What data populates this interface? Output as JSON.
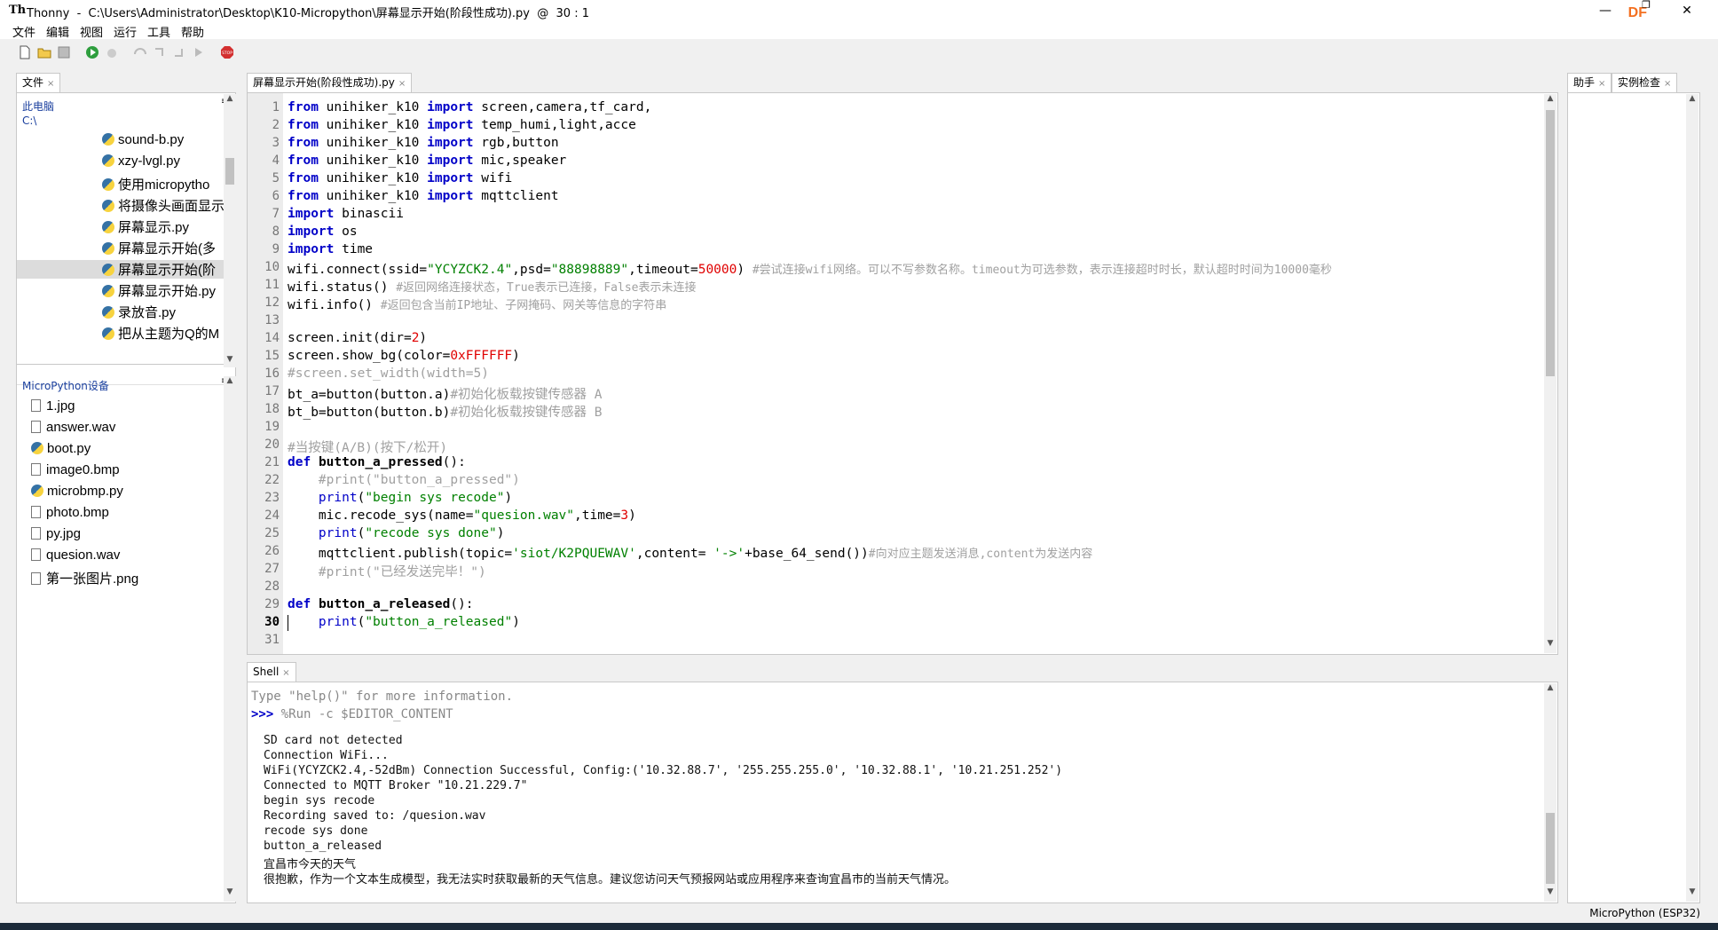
{
  "window": {
    "app_name": "Thonny",
    "path": "C:\\Users\\Administrator\\Desktop\\K10-Micropython\\屏幕显示开始(阶段性成功).py",
    "cursor": "@  30 : 1",
    "brand": "DF",
    "minimize": "—",
    "restore": "❐",
    "close": "✕"
  },
  "menu": [
    "文件",
    "编辑",
    "视图",
    "运行",
    "工具",
    "帮助"
  ],
  "files_panel": {
    "tab": "文件",
    "section1_title": "此电脑",
    "drive": "C:\\",
    "computer_files": [
      "sound-b.py",
      "xzy-lvgl.py",
      "使用micropytho",
      "将摄像头画面显示",
      "屏幕显示.py",
      "屏幕显示开始(多",
      "屏幕显示开始(阶",
      "屏幕显示开始.py",
      "录放音.py",
      "把从主题为Q的M"
    ],
    "section2_title": "MicroPython设备",
    "device_files": [
      {
        "name": "1.jpg",
        "type": "file"
      },
      {
        "name": "answer.wav",
        "type": "file"
      },
      {
        "name": "boot.py",
        "type": "py"
      },
      {
        "name": "image0.bmp",
        "type": "file"
      },
      {
        "name": "microbmp.py",
        "type": "py"
      },
      {
        "name": "photo.bmp",
        "type": "file"
      },
      {
        "name": "py.jpg",
        "type": "file"
      },
      {
        "name": "quesion.wav",
        "type": "file"
      },
      {
        "name": "第一张图片.png",
        "type": "file"
      }
    ]
  },
  "editor": {
    "tab": "屏幕显示开始(阶段性成功).py",
    "line_count": 31
  },
  "right_panel": {
    "tabs": [
      "助手",
      "实例检查"
    ]
  },
  "shell": {
    "tab": "Shell",
    "help_line": "Type \"help()\" for more information.",
    "prompt": ">>>",
    "command": " %Run -c $EDITOR_CONTENT",
    "output": [
      "SD card not detected",
      "Connection WiFi...",
      "WiFi(YCYZCK2.4,-52dBm) Connection Successful, Config:('10.32.88.7', '255.255.255.0', '10.32.88.1', '10.21.251.252')",
      "Connected to MQTT Broker \"10.21.229.7\"",
      "begin sys recode",
      "Recording saved to: /quesion.wav",
      "recode sys done",
      "button_a_released",
      "宜昌市今天的天气",
      "很抱歉，作为一个文本生成模型，我无法实时获取最新的天气信息。建议您访问天气预报网站或应用程序来查询宜昌市的当前天气情况。"
    ]
  },
  "status": {
    "interpreter": "MicroPython (ESP32)"
  }
}
